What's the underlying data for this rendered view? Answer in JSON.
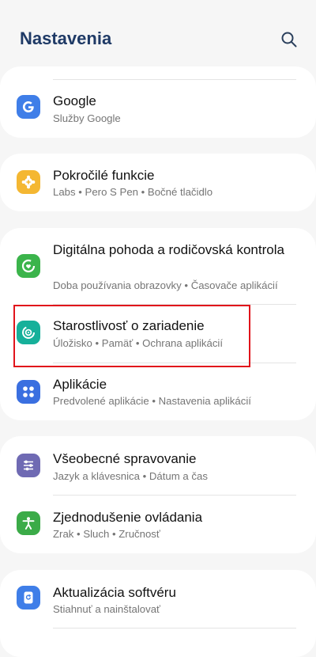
{
  "header": {
    "title": "Nastavenia",
    "search_icon": "search-icon"
  },
  "items": {
    "google": {
      "label": "Google",
      "sub": "Služby Google",
      "icon": "google-icon",
      "icon_color": "#3f7ee8"
    },
    "advanced": {
      "label": "Pokročilé funkcie",
      "sub": "Labs • Pero S Pen • Bočné tlačidlo",
      "icon": "gear-plus-icon",
      "icon_color": "#f4b732"
    },
    "wellbeing": {
      "label": "Digitálna pohoda a rodičovská kontrola",
      "sub": "Doba používania obrazovky • Časovače aplikácií",
      "icon": "heart-ring-icon",
      "icon_color": "#3bb44b"
    },
    "device_care": {
      "label": "Starostlivosť o zariadenie",
      "sub": "Úložisko • Pamäť • Ochrana aplikácií",
      "icon": "device-care-icon",
      "icon_color": "#16b09a"
    },
    "apps": {
      "label": "Aplikácie",
      "sub": "Predvolené aplikácie • Nastavenia aplikácií",
      "icon": "apps-grid-icon",
      "icon_color": "#3a6fe0"
    },
    "general": {
      "label": "Všeobecné spravovanie",
      "sub": "Jazyk a klávesnica • Dátum a čas",
      "icon": "sliders-icon",
      "icon_color": "#6f6ab3"
    },
    "accessibility": {
      "label": "Zjednodušenie ovládania",
      "sub": "Zrak • Sluch • Zručnosť",
      "icon": "accessibility-icon",
      "icon_color": "#3bab48"
    },
    "software_update": {
      "label": "Aktualizácia softvéru",
      "sub": "Stiahnuť a nainštalovať",
      "icon": "update-icon",
      "icon_color": "#3f7ee8"
    }
  },
  "highlight_color": "#e1141b"
}
